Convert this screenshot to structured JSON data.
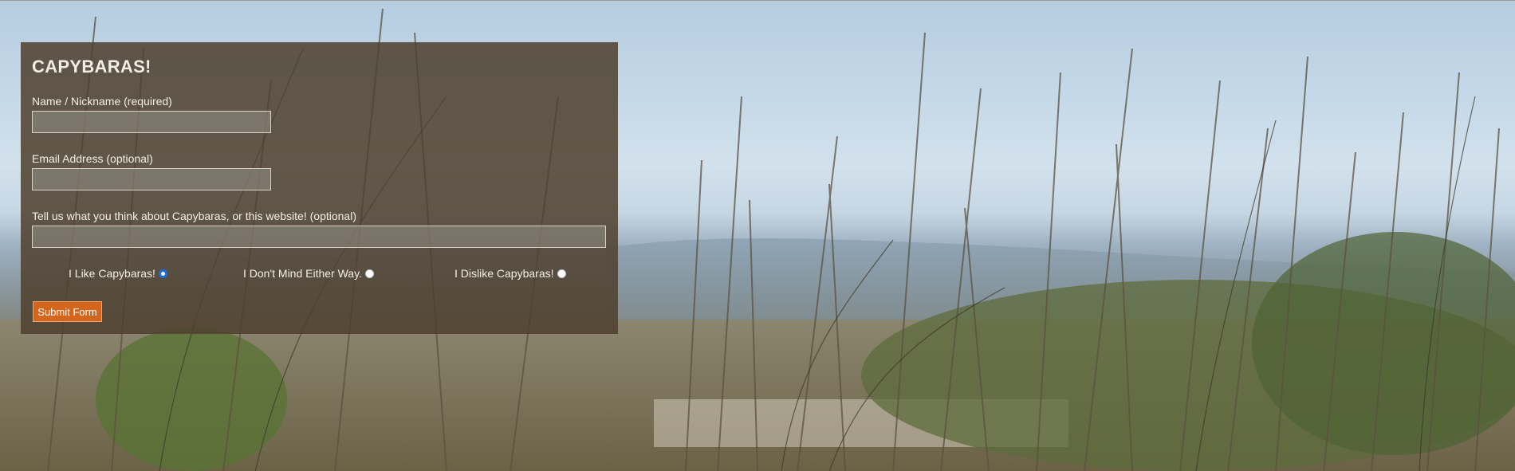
{
  "form": {
    "title": "CAPYBARAS!",
    "name_label": "Name / Nickname (required)",
    "name_value": "",
    "email_label": "Email Address (optional)",
    "email_value": "",
    "comment_label": "Tell us what you think about Capybaras, or this website! (optional)",
    "comment_value": "",
    "options": [
      {
        "label": "I Like Capybaras!",
        "checked": true
      },
      {
        "label": "I Don't Mind Either Way.",
        "checked": false
      },
      {
        "label": "I Dislike Capybaras!",
        "checked": false
      }
    ],
    "submit_label": "Submit Form"
  },
  "colors": {
    "panel_bg": "#4e402e",
    "button_bg": "#d4651d",
    "radio_selected": "#1a6fe0"
  }
}
